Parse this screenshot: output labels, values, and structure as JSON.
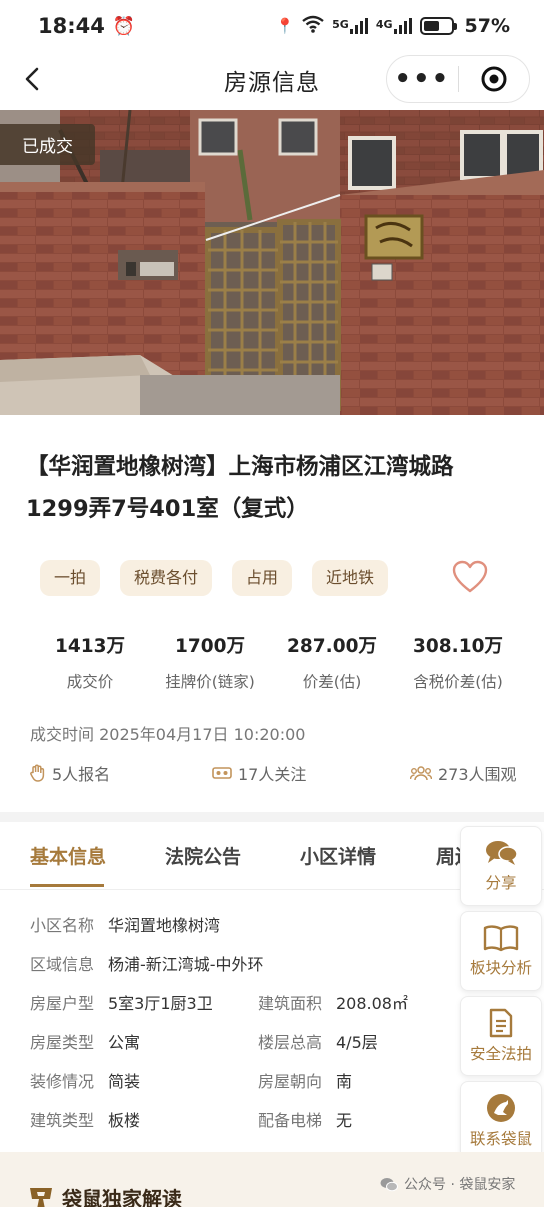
{
  "status_bar": {
    "time": "18:44",
    "network_5g": "5G",
    "network_4g": "4G",
    "battery_percent": "57%",
    "battery_level": 0.57
  },
  "nav": {
    "title": "房源信息"
  },
  "photo": {
    "sold_badge": "已成交"
  },
  "listing": {
    "title": "【华润置地橡树湾】上海市杨浦区江湾城路1299弄7号401室（复式）",
    "tags": [
      "一拍",
      "税费各付",
      "占用",
      "近地铁"
    ]
  },
  "stats": [
    {
      "value": "1413万",
      "label": "成交价"
    },
    {
      "value": "1700万",
      "label": "挂牌价(链家)"
    },
    {
      "value": "287.00万",
      "label": "价差(估)"
    },
    {
      "value": "308.10万",
      "label": "含税价差(估)"
    }
  ],
  "deal_time": "成交时间 2025年04月17日 10:20:00",
  "engagement": {
    "signups": "5人报名",
    "followers": "17人关注",
    "viewers": "273人围观"
  },
  "tabs": [
    "基本信息",
    "法院公告",
    "小区详情",
    "周边"
  ],
  "basic_info": {
    "community_label": "小区名称",
    "community": "华润置地橡树湾",
    "area_label": "区域信息",
    "area": "杨浦-新江湾城-中外环",
    "layout_label": "房屋户型",
    "layout": "5室3厅1厨3卫",
    "build_area_label": "建筑面积",
    "build_area": "208.08㎡",
    "house_type_label": "房屋类型",
    "house_type": "公寓",
    "floor_label": "楼层总高",
    "floor": "4/5层",
    "decor_label": "装修情况",
    "decor": "简装",
    "orientation_label": "房屋朝向",
    "orientation": "南",
    "building_type_label": "建筑类型",
    "building_type": "板楼",
    "elevator_label": "配备电梯",
    "elevator": "无"
  },
  "sidebar": [
    {
      "label": "分享",
      "icon": "chat-bubbles-icon"
    },
    {
      "label": "板块分析",
      "icon": "book-icon"
    },
    {
      "label": "安全法拍",
      "icon": "document-icon"
    },
    {
      "label": "联系袋鼠",
      "icon": "kangaroo-logo-icon"
    }
  ],
  "footer": {
    "section_title": "袋鼠独家解读",
    "watermark": "公众号 · 袋鼠安家"
  },
  "colors": {
    "accent": "#a67a3c",
    "tag_bg": "#f8efe1",
    "heart": "#e0907e"
  }
}
